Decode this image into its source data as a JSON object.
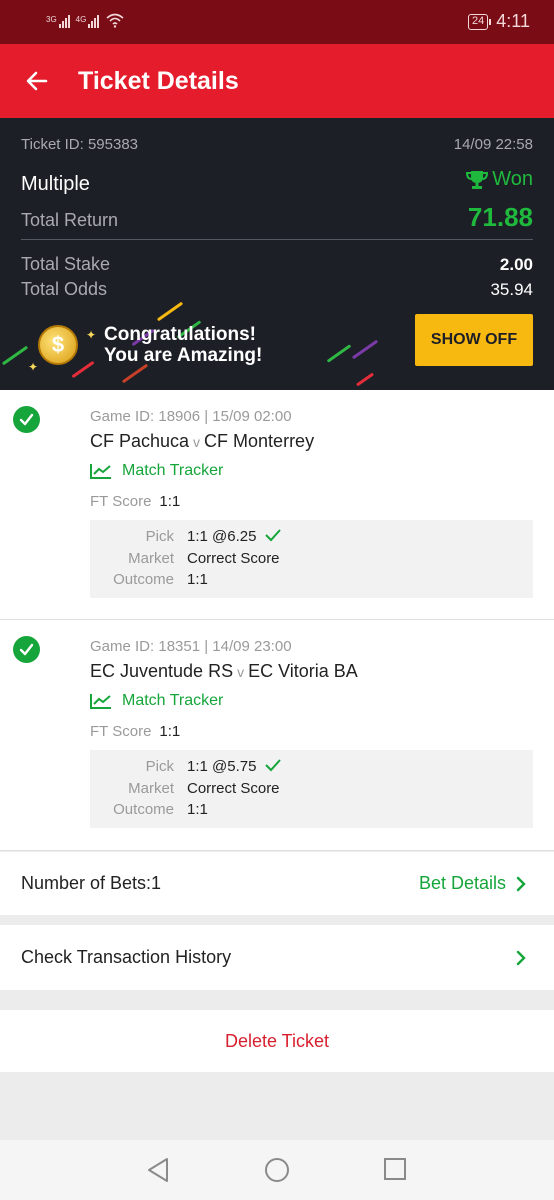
{
  "status_bar": {
    "signal1": "3G",
    "signal2": "4G",
    "battery": "24",
    "time": "4:11"
  },
  "header": {
    "title": "Ticket Details"
  },
  "ticket": {
    "id_label": "Ticket ID: 595383",
    "datetime": "14/09 22:58",
    "type": "Multiple",
    "status": "Won",
    "total_return_label": "Total Return",
    "total_return": "71.88",
    "total_stake_label": "Total Stake",
    "total_stake": "2.00",
    "total_odds_label": "Total Odds",
    "total_odds": "35.94"
  },
  "banner": {
    "line1": "Congratulations!",
    "line2": "You are Amazing!",
    "button": "SHOW OFF",
    "coin_symbol": "$"
  },
  "games": [
    {
      "game_line": "Game ID: 18906 | 15/09 02:00",
      "home": "CF Pachuca",
      "vs": "v",
      "away": "CF Monterrey",
      "tracker_label": "Match Tracker",
      "ft_label": "FT Score",
      "ft_score": "1:1",
      "pick_label": "Pick",
      "pick": "1:1 @6.25",
      "market_label": "Market",
      "market": "Correct Score",
      "outcome_label": "Outcome",
      "outcome": "1:1"
    },
    {
      "game_line": "Game ID: 18351 | 14/09 23:00",
      "home": "EC Juventude RS",
      "vs": "v",
      "away": "EC Vitoria BA",
      "tracker_label": "Match Tracker",
      "ft_label": "FT Score",
      "ft_score": "1:1",
      "pick_label": "Pick",
      "pick": "1:1 @5.75",
      "market_label": "Market",
      "market": "Correct Score",
      "outcome_label": "Outcome",
      "outcome": "1:1"
    }
  ],
  "footer": {
    "bets_label": "Number of Bets:1",
    "bet_details": "Bet Details",
    "transaction_history": "Check Transaction History",
    "delete": "Delete Ticket"
  },
  "colors": {
    "header_red": "#e41c2b",
    "status_red": "#7a0c16",
    "win_green": "#16a53a",
    "dark_panel": "#1d1f26",
    "button_yellow": "#f7b80f"
  },
  "icons": [
    "back-arrow-icon",
    "trophy-icon",
    "check-circle-icon",
    "chart-line-icon",
    "checkmark-icon",
    "chevron-right-icon",
    "nav-back-icon",
    "nav-home-icon",
    "nav-recents-icon"
  ]
}
